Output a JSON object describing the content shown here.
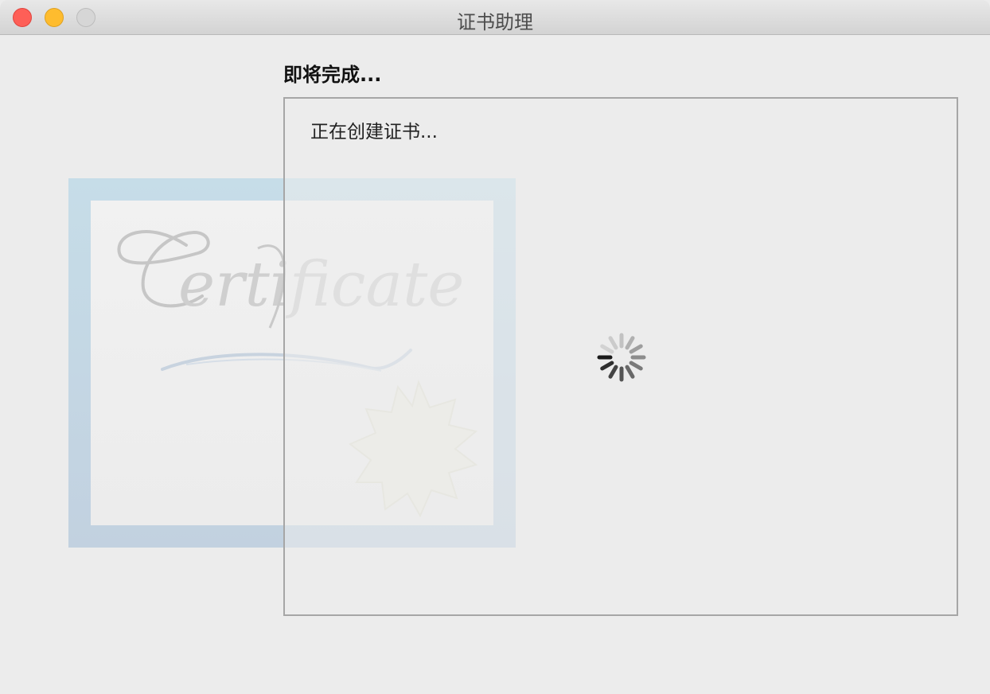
{
  "window": {
    "title": "证书助理"
  },
  "traffic_lights": {
    "close_color": "#fe5f57",
    "minimize_color": "#febc2e",
    "zoom_color": "#d6d6d6"
  },
  "step": {
    "heading": "即将完成..."
  },
  "panel": {
    "status": "正在创建证书..."
  },
  "illustration": {
    "lettering": "Certificate",
    "icon": "certificate-icon"
  },
  "spinner": {
    "icon": "spinner-icon"
  }
}
